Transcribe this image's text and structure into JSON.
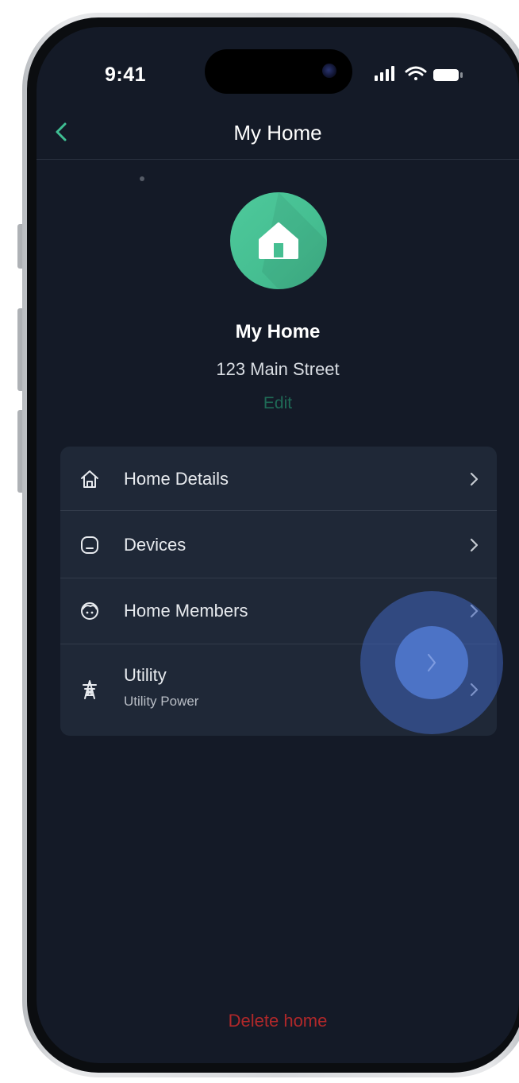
{
  "status_bar": {
    "time": "9:41",
    "icons": [
      "signal-icon",
      "wifi-icon",
      "battery-icon"
    ]
  },
  "nav": {
    "title": "My Home",
    "back_icon": "chevron-left-icon"
  },
  "home": {
    "icon": "house-icon",
    "name": "My Home",
    "address": "123 Main Street",
    "edit_label": "Edit"
  },
  "menu": {
    "items": [
      {
        "label": "Home Details",
        "icon": "house-outline-icon"
      },
      {
        "label": "Devices",
        "icon": "device-icon"
      },
      {
        "label": "Home Members",
        "icon": "members-icon"
      },
      {
        "label": "Utility",
        "sublabel": "Utility Power",
        "icon": "power-tower-icon"
      }
    ]
  },
  "footer": {
    "delete_label": "Delete home"
  },
  "colors": {
    "background": "#141a27",
    "card": "#1f2837",
    "accent_green": "#4ec99b",
    "edit_text": "#1f6a56",
    "danger": "#b0282a",
    "touch_indicator": "#4a6fc4"
  }
}
